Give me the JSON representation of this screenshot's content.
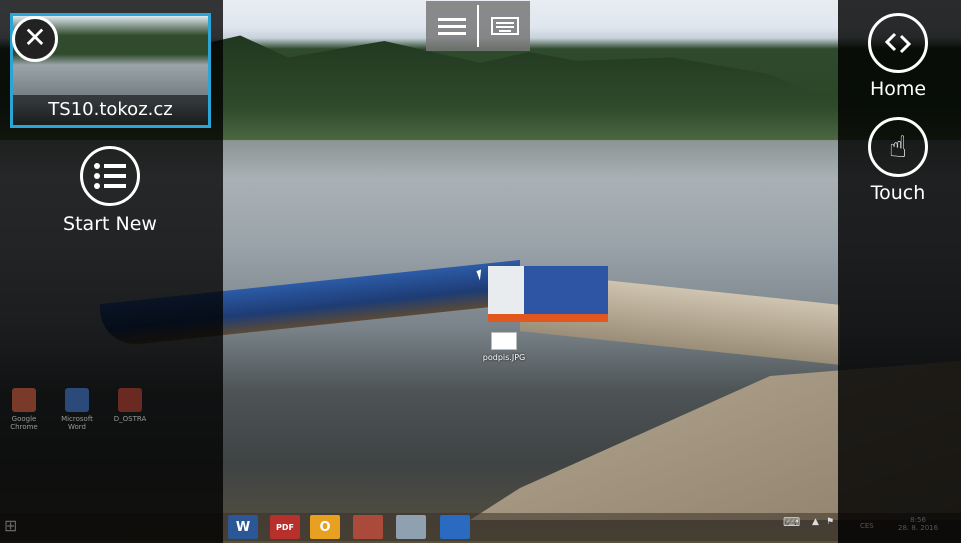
{
  "session": {
    "name": "TS10.tokoz.cz",
    "close_icon": "close-icon"
  },
  "left_panel": {
    "start_new_label": "Start New"
  },
  "right_panel": {
    "home_label": "Home",
    "touch_label": "Touch"
  },
  "top_toolbar": {
    "menu_icon": "hamburger-icon",
    "keyboard_icon": "keyboard-icon"
  },
  "desktop": {
    "file_label": "podpis.JPG",
    "dim_icons": [
      {
        "label": "Google Chrome"
      },
      {
        "label": "Microsoft Word"
      },
      {
        "label": "D_OSTRA"
      }
    ]
  },
  "taskbar": {
    "apps": [
      "W",
      "PDF",
      "O",
      "",
      "",
      ""
    ],
    "language": "CES",
    "time": "8:56",
    "date": "28. 8. 2016"
  },
  "colors": {
    "accent": "#2aa5d6"
  }
}
